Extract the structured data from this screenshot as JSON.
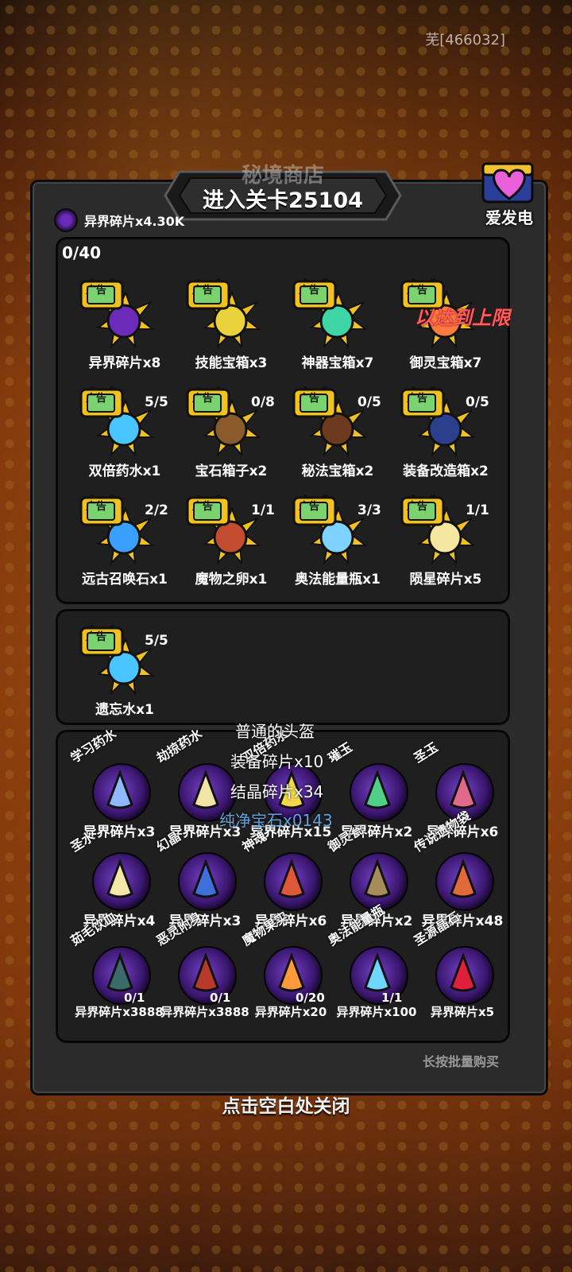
{
  "player_code": "芜[466032]",
  "title": {
    "main": "秘境商店",
    "overlay": "进入关卡25104"
  },
  "charge_button": {
    "label": "爱发电"
  },
  "currency": {
    "label": "异界碎片x4.30K"
  },
  "ad_section": {
    "progress": "0/40",
    "limit_note": "以达到上限",
    "items": [
      {
        "label": "异界碎片x8",
        "qty": "",
        "icon": "purple-orb-icon"
      },
      {
        "label": "技能宝箱x3",
        "qty": "",
        "icon": "yellow-chest-icon"
      },
      {
        "label": "神器宝箱x7",
        "qty": "",
        "icon": "green-chest-icon"
      },
      {
        "label": "御灵宝箱x7",
        "qty": "",
        "icon": "orange-chest-icon"
      },
      {
        "label": "双倍药水x1",
        "qty": "5/5",
        "icon": "potion-icon"
      },
      {
        "label": "宝石箱子x2",
        "qty": "0/8",
        "icon": "gem-bag-icon"
      },
      {
        "label": "秘法宝箱x2",
        "qty": "0/5",
        "icon": "dark-chest-icon"
      },
      {
        "label": "装备改造箱x2",
        "qty": "0/5",
        "icon": "equip-box-icon"
      },
      {
        "label": "远古召唤石x1",
        "qty": "2/2",
        "icon": "summon-stone-icon"
      },
      {
        "label": "魔物之卵x1",
        "qty": "1/1",
        "icon": "monster-egg-icon"
      },
      {
        "label": "奥法能量瓶x1",
        "qty": "3/3",
        "icon": "energy-bottle-icon"
      },
      {
        "label": "陨星碎片x5",
        "qty": "1/1",
        "icon": "meteor-shard-icon"
      }
    ],
    "ad_badge": "广告"
  },
  "ad_section_2": {
    "items": [
      {
        "label": "遗忘水x1",
        "qty": "5/5",
        "icon": "forget-water-icon"
      }
    ]
  },
  "shop_section": {
    "items": [
      {
        "tag": "学习药水",
        "price": "异界碎片x3",
        "count": "",
        "icon": "flask-icon"
      },
      {
        "tag": "劫掠药水",
        "price": "异界碎片x3",
        "count": "",
        "icon": "flask-icon"
      },
      {
        "tag": "双倍药水",
        "price": "异界碎片x15",
        "count": "",
        "icon": "hourglass-icon"
      },
      {
        "tag": "璀玉",
        "price": "异界碎片x2",
        "count": "",
        "icon": "jade-icon"
      },
      {
        "tag": "圣玉",
        "price": "异界碎片x6",
        "count": "",
        "icon": "crystal-icon"
      },
      {
        "tag": "圣水",
        "price": "异界碎片x4",
        "count": "",
        "icon": "holy-water-icon"
      },
      {
        "tag": "幻晶",
        "price": "异界碎片x3",
        "count": "",
        "icon": "phantom-crystal-icon"
      },
      {
        "tag": "神魂",
        "price": "异界碎片x6",
        "count": "",
        "icon": "soul-flame-icon"
      },
      {
        "tag": "御灵瓮",
        "price": "异界碎片x2",
        "count": "",
        "icon": "urn-icon"
      },
      {
        "tag": "传说遗物袋",
        "price": "异界碎片x48",
        "count": "",
        "icon": "relic-bag-icon"
      },
      {
        "tag": "茹毛饮血",
        "price": "异界碎片x3888",
        "count": "0/1",
        "icon": "warrior-icon"
      },
      {
        "tag": "恶灵附身",
        "price": "异界碎片x3888",
        "count": "0/1",
        "icon": "evil-spirit-icon"
      },
      {
        "tag": "魔物果实",
        "price": "异界碎片x20",
        "count": "0/20",
        "icon": "monster-fruit-icon"
      },
      {
        "tag": "奥法能量瓶",
        "price": "异界碎片x100",
        "count": "1/1",
        "icon": "energy-bottle-icon"
      },
      {
        "tag": "圣源晶石",
        "price": "异界碎片x5",
        "count": "",
        "icon": "ruby-icon"
      }
    ]
  },
  "tooltip": {
    "line1": "普通的头盔",
    "line2": "装备碎片x10",
    "line3": "结晶碎片x34",
    "line4": "纯净宝石x0143"
  },
  "footer": {
    "bulk_hint": "长按批量购买",
    "close_hint": "点击空白处关闭"
  },
  "colors": {
    "panel": "#2b2b2c",
    "section": "#1f1f20",
    "limit_red": "#ff5c5c",
    "ad_yellow": "#f2c21b"
  }
}
